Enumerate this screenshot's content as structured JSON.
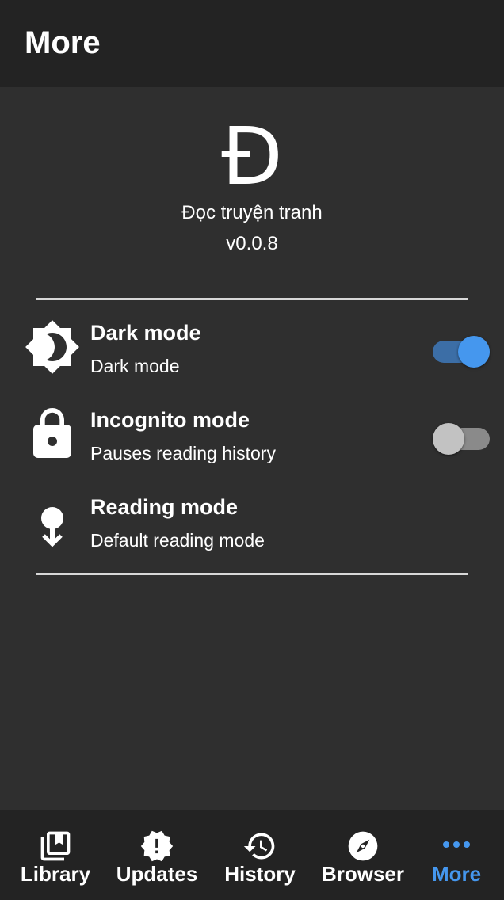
{
  "header": {
    "title": "More"
  },
  "about": {
    "logo": "Đ",
    "app_name": "Đọc truyện tranh",
    "version": "v0.0.8"
  },
  "settings": [
    {
      "title": "Dark mode",
      "subtitle": "Dark mode",
      "icon": "brightness-icon",
      "toggle": true
    },
    {
      "title": "Incognito mode",
      "subtitle": "Pauses reading history",
      "icon": "lock-icon",
      "toggle": false
    },
    {
      "title": "Reading mode",
      "subtitle": "Default reading mode",
      "icon": "reading-mode-icon"
    }
  ],
  "bottom_nav": [
    {
      "label": "Library",
      "icon": "library-icon"
    },
    {
      "label": "Updates",
      "icon": "updates-icon"
    },
    {
      "label": "History",
      "icon": "history-icon"
    },
    {
      "label": "Browser",
      "icon": "compass-icon"
    },
    {
      "label": "More",
      "icon": "more-dots-icon",
      "active": true
    }
  ],
  "colors": {
    "appbar_bg": "#232323",
    "content_bg": "#2f2f2f",
    "accent": "#4597ee",
    "toggle_on_track": "#3c6ea6",
    "toggle_off_thumb": "#c2c2c2"
  }
}
